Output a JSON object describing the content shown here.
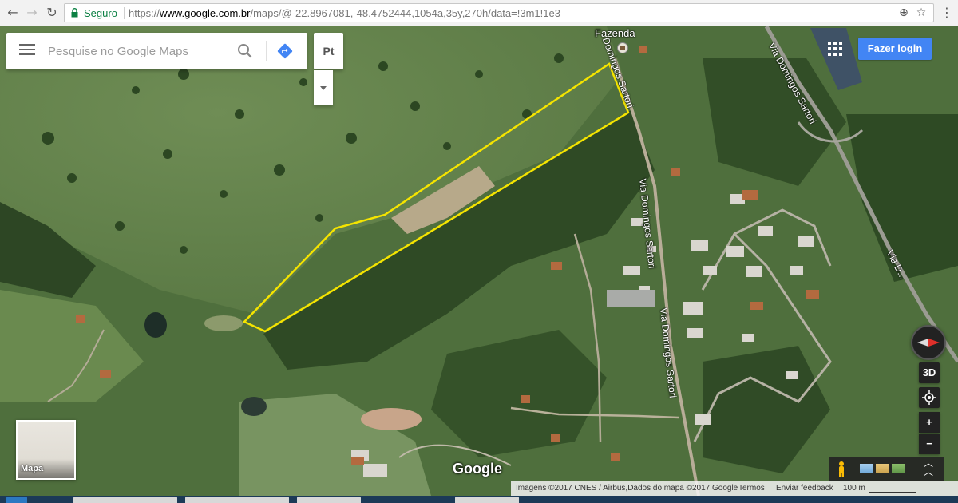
{
  "browser": {
    "back_icon": "back-arrow-icon",
    "forward_icon": "forward-arrow-icon",
    "reload_icon": "reload-icon",
    "secure_label": "Seguro",
    "url_protocol": "https://",
    "url_host": "www.google.com.br",
    "url_path": "/maps/@-22.8967081,-48.4752444,1054a,35y,270h/data=!3m1!1e3",
    "zoom_icon": "zoom-icon",
    "bookmark_icon": "star-icon",
    "menu_icon": "more-vert-icon"
  },
  "maps": {
    "search_placeholder": "Pesquise no Google Maps",
    "language_button": "Pt",
    "login_button": "Fazer login",
    "place_label": "Fazenda",
    "road_labels": [
      "Via Domingos Sartori",
      "Via Domingos Sartori",
      "Domingos Sartori",
      "Via Domingos Sartori",
      "Via D..."
    ],
    "minimap_label": "Mapa",
    "google_logo": "Google",
    "control_3d": "3D",
    "zoom_in": "+",
    "zoom_out": "−",
    "footer": {
      "imagery": "Imagens ©2017 CNES / Airbus,Dados do mapa ©2017 Google",
      "terms": "Termos",
      "feedback": "Enviar feedback",
      "scale": "100 m"
    },
    "polygon_color": "#f5e400"
  }
}
